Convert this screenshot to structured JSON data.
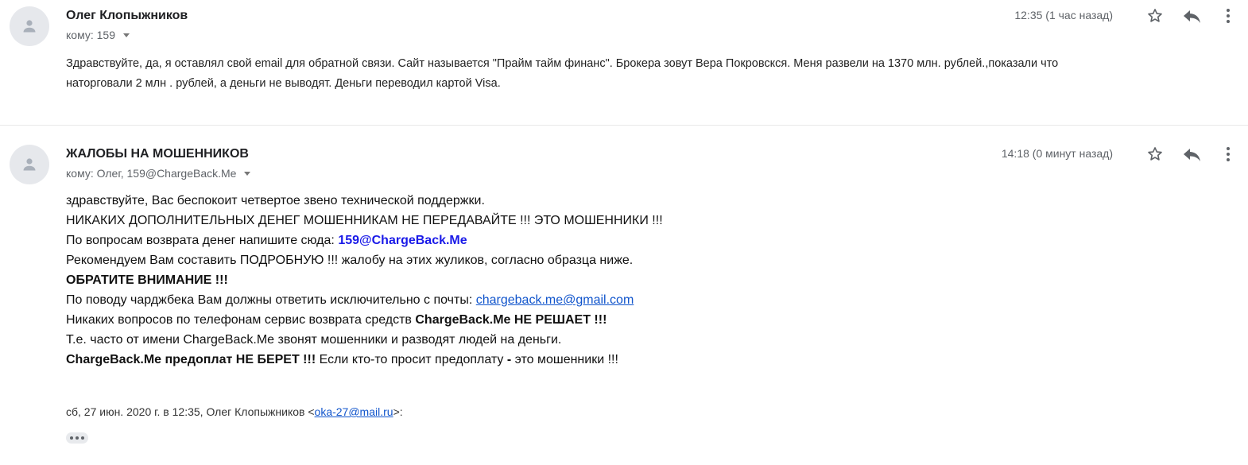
{
  "messages": [
    {
      "sender": "Олег Клопыжников",
      "recipients": "кому: 159",
      "time": "12:35 (1 час назад)",
      "body": [
        "Здравствуйте, да, я оставлял свой   email для обратной связи. Сайт называется \"Прайм тайм финанс\". Брокера зовут Вера Покровскся. Меня развели на 1370 млн. рублей.,показали что",
        "наторговали 2 млн . рублей,  а деньги не выводят. Деньги переводил картой Visa."
      ]
    },
    {
      "sender": "ЖАЛОБЫ НА МОШЕННИКОВ",
      "recipients": "кому: Олег, 159@ChargeBack.Me",
      "time": "14:18 (0 минут назад)",
      "body": {
        "l1": "здравствуйте, Вас беспокоит четвертое звено технической поддержки.",
        "l2": "НИКАКИХ ДОПОЛНИТЕЛЬНЫХ ДЕНЕГ МОШЕННИКАМ НЕ ПЕРЕДАВАЙТЕ !!! ЭТО МОШЕННИКИ !!!",
        "l3_text": "По вопросам возврата денег напишите сюда: ",
        "l3_email": "159@ChargeBack.Me",
        "l4": "Рекомендуем Вам составить ПОДРОБНУЮ !!! жалобу на этих жуликов, согласно образца ниже.",
        "l5": "ОБРАТИТЕ ВНИМАНИЕ !!!",
        "l6_text": "По поводу чарджбека Вам должны ответить исключительно с почты: ",
        "l6_link": "chargeback.me@gmail.com",
        "l7_text": "Никаких вопросов по телефонам сервис возврата средств ",
        "l7_bold": "ChargeBack.Me НЕ РЕШАЕТ !!!",
        "l8": "Т.е. часто от имени ChargeBack.Me звонят мошенники и разводят людей на деньги.",
        "l9_bold1": "ChargeBack.Me предоплат НЕ БЕРЕТ !!!",
        "l9_text1": " Если кто-то просит предоплату ",
        "l9_bold2": "-",
        "l9_text2": " это мошенники !!!"
      },
      "quote": {
        "prefix": "сб, 27 июн. 2020 г. в 12:35, Олег Клопыжников <",
        "email": "oka-27@mail.ru",
        "suffix": ">:"
      }
    }
  ],
  "icons": {
    "avatar": "person-icon",
    "star": "star-icon",
    "reply": "reply-icon",
    "more": "more-vert-icon",
    "expand": "show-trimmed-content-icon"
  },
  "colors": {
    "link": "#1155cc",
    "email_highlight": "#1a1ae8",
    "avatar_bg": "#e6e8ec"
  }
}
